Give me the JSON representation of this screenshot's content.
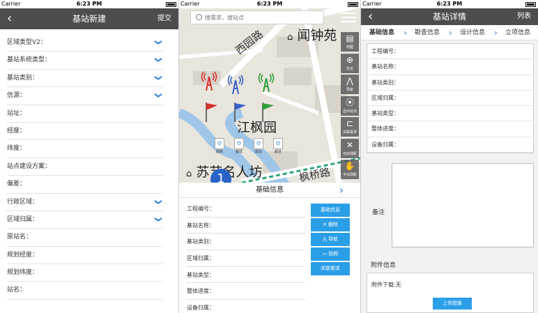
{
  "status_bar": {
    "carrier": "Carrier",
    "time": "6:23 PM"
  },
  "screen_new": {
    "back_icon": "chevron-left-icon",
    "title": "基站新建",
    "submit_label": "提交",
    "fields": [
      {
        "label": "区域类型V2：",
        "dropdown": true
      },
      {
        "label": "基站系统类型：",
        "dropdown": true
      },
      {
        "label": "基站类别：",
        "dropdown": true
      },
      {
        "label": "信源：",
        "dropdown": true
      },
      {
        "label": "站址：",
        "dropdown": false
      },
      {
        "label": "经度：",
        "dropdown": false
      },
      {
        "label": "纬度：",
        "dropdown": false
      },
      {
        "label": "站点建设方案：",
        "dropdown": false
      },
      {
        "label": "偏差：",
        "dropdown": false
      },
      {
        "label": "行政区域：",
        "dropdown": true
      },
      {
        "label": "区域归属：",
        "dropdown": true
      },
      {
        "label": "原站名：",
        "dropdown": false
      },
      {
        "label": "规划经度：",
        "dropdown": false
      },
      {
        "label": "规划纬度：",
        "dropdown": false
      },
      {
        "label": "站名：",
        "dropdown": false
      }
    ]
  },
  "screen_map": {
    "search_placeholder": "搜需求，搜站点",
    "map_labels": {
      "poi_top": "闻钟苑",
      "road_west": "西园路",
      "poi_center": "江枫园",
      "poi_bottom": "苏艺名人坊",
      "road_bottom": "枫桥路",
      "pin_number": "1"
    },
    "tools": [
      "地图",
      "定位",
      "导航",
      "显示站点",
      "关联需求",
      "自动测距",
      "手动测距"
    ],
    "legend": [
      "超高",
      "超低",
      "超远",
      "超近"
    ],
    "colors": {
      "tower_red": "#d9312b",
      "tower_blue": "#3a5fc8",
      "tower_green": "#2f9e3a"
    },
    "panel": {
      "title": "基础信息",
      "rows": [
        "工程编号：",
        "基站名称：",
        "基站类别：",
        "区域归属：",
        "基站类型：",
        "整体进度：",
        "设备归属："
      ],
      "buttons": [
        "基础信息",
        "删除",
        "导航",
        "拍照",
        "关联需求"
      ]
    }
  },
  "screen_detail": {
    "title": "基站详情",
    "list_label": "列表",
    "tabs": [
      "基础信息",
      "勘查信息",
      "设计信息",
      "立项信息"
    ],
    "info_rows": [
      "工程编号：",
      "基站名称：",
      "基站类别：",
      "区域归属：",
      "基站类型：",
      "整体进度：",
      "设备归属："
    ],
    "note_label": "备注",
    "attachment_title": "附件信息",
    "attachment_download": "附件下载:无",
    "upload_button": "上传图像"
  }
}
